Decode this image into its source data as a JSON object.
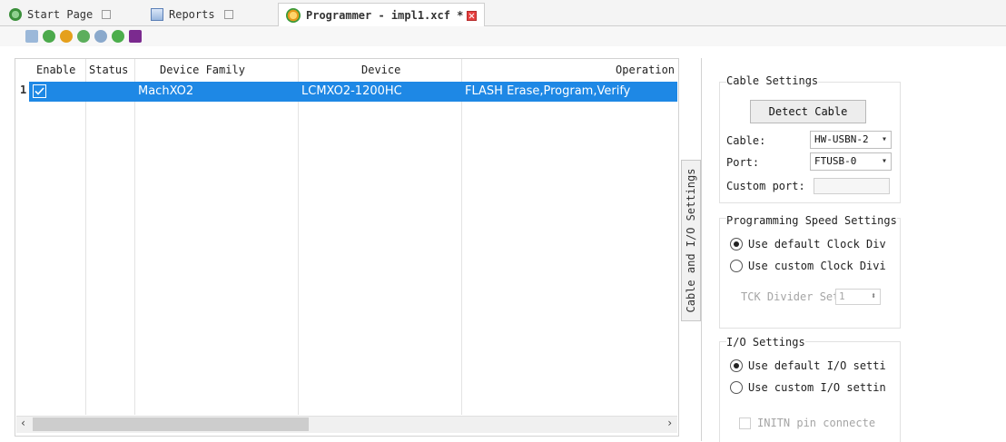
{
  "tabs": [
    {
      "label": "Start Page"
    },
    {
      "label": "Reports"
    },
    {
      "label": "Programmer - impl1.xcf *"
    }
  ],
  "grid": {
    "columns": [
      "Enable",
      "Status",
      "Device Family",
      "Device",
      "Operation"
    ],
    "rows": [
      {
        "index": "1",
        "enable": true,
        "status": "",
        "family": "MachXO2",
        "device": "LCMXO2-1200HC",
        "operation": "FLASH Erase,Program,Verify"
      }
    ]
  },
  "side_tab": {
    "label": "Cable and I/O Settings"
  },
  "cable": {
    "title": "Cable Settings",
    "detect_label": "Detect Cable",
    "cable_label": "Cable:",
    "cable_value": "HW-USBN-2",
    "port_label": "Port:",
    "port_value": "FTUSB-0",
    "custom_port_label": "Custom port:"
  },
  "speed": {
    "title": "Programming Speed Settings",
    "opt_default": "Use default Clock Div",
    "opt_custom": "Use custom Clock Divi",
    "divider_label": "TCK Divider Set",
    "divider_value": "1"
  },
  "io": {
    "title": "I/O Settings",
    "opt_default": "Use default I/O setti",
    "opt_custom": "Use custom I/O settin",
    "initn_label": "INITN pin connecte"
  },
  "colors": {
    "selection": "#1e88e5",
    "close": "#e64040"
  }
}
